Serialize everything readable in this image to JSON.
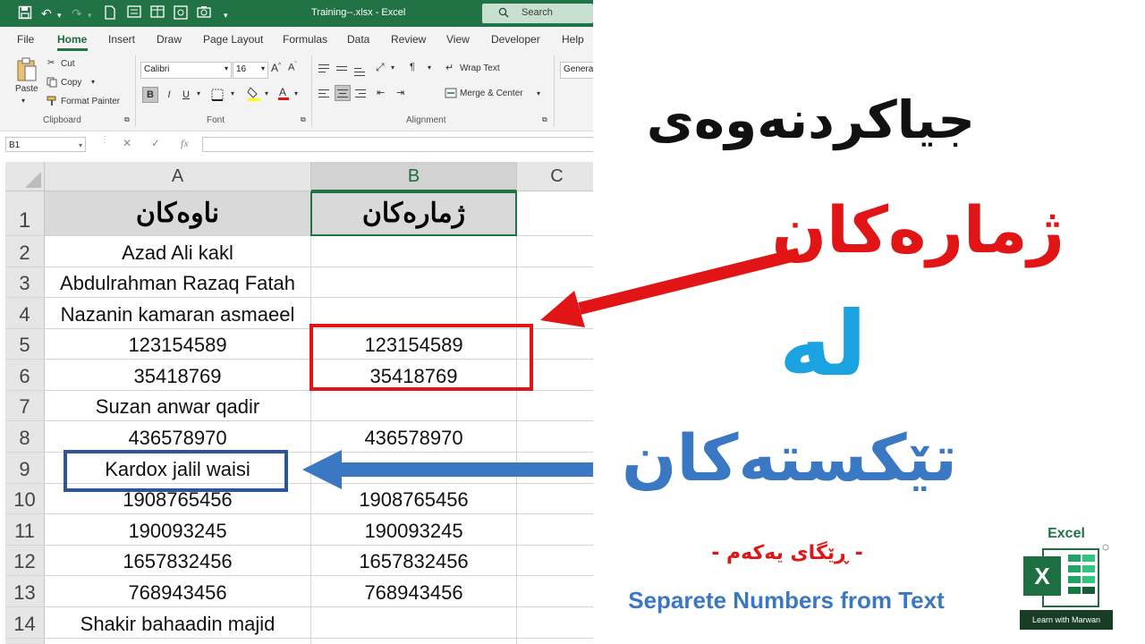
{
  "window": {
    "title": "Training--.xlsx  -  Excel",
    "search_placeholder": "Search"
  },
  "tabs": [
    "File",
    "Home",
    "Insert",
    "Draw",
    "Page Layout",
    "Formulas",
    "Data",
    "Review",
    "View",
    "Developer",
    "Help"
  ],
  "active_tab": "Home",
  "ribbon": {
    "clipboard": {
      "paste": "Paste",
      "cut": "Cut",
      "copy": "Copy",
      "format_painter": "Format Painter",
      "group_label": "Clipboard"
    },
    "font": {
      "name": "Calibri",
      "size": "16",
      "bold": "B",
      "italic": "I",
      "underline": "U",
      "group_label": "Font"
    },
    "alignment": {
      "wrap_text": "Wrap Text",
      "merge_center": "Merge & Center",
      "group_label": "Alignment"
    },
    "number": {
      "format": "Genera"
    }
  },
  "formula_bar": {
    "name_box": "B1",
    "fx": "fx",
    "cancel": "✕",
    "enter": "✓",
    "value": ""
  },
  "sheet": {
    "columns": [
      "A",
      "B",
      "C"
    ],
    "selected_column": "B",
    "rows": [
      {
        "num": "1",
        "a": "ناوەکان",
        "b": "ژمارەکان"
      },
      {
        "num": "2",
        "a": "Azad Ali kakl",
        "b": ""
      },
      {
        "num": "3",
        "a": "Abdulrahman Razaq Fatah",
        "b": ""
      },
      {
        "num": "4",
        "a": "Nazanin kamaran asmaeel",
        "b": ""
      },
      {
        "num": "5",
        "a": "123154589",
        "b": "123154589"
      },
      {
        "num": "6",
        "a": "35418769",
        "b": "35418769"
      },
      {
        "num": "7",
        "a": "Suzan anwar qadir",
        "b": ""
      },
      {
        "num": "8",
        "a": "436578970",
        "b": "436578970"
      },
      {
        "num": "9",
        "a": "Kardox jalil waisi",
        "b": ""
      },
      {
        "num": "10",
        "a": "1908765456",
        "b": "1908765456"
      },
      {
        "num": "11",
        "a": "190093245",
        "b": "190093245"
      },
      {
        "num": "12",
        "a": "1657832456",
        "b": "1657832456"
      },
      {
        "num": "13",
        "a": "768943456",
        "b": "768943456"
      },
      {
        "num": "14",
        "a": "Shakir bahaadin majid",
        "b": ""
      }
    ]
  },
  "overlay": {
    "title": "جیاکردنەوەی",
    "line2": "ژمارەکان",
    "line3": "لە",
    "line4": "تێکستەکان",
    "subtitle": "- ڕێگای یەکەم -",
    "english": "Separete Numbers from Text",
    "colors": {
      "red": "#e11515",
      "blue": "#3a78c3",
      "cyan": "#1aa3e0",
      "excel_green": "#217346"
    }
  },
  "logo": {
    "top": "Excel",
    "badge": "X",
    "bottom": "Learn with Marwan"
  }
}
